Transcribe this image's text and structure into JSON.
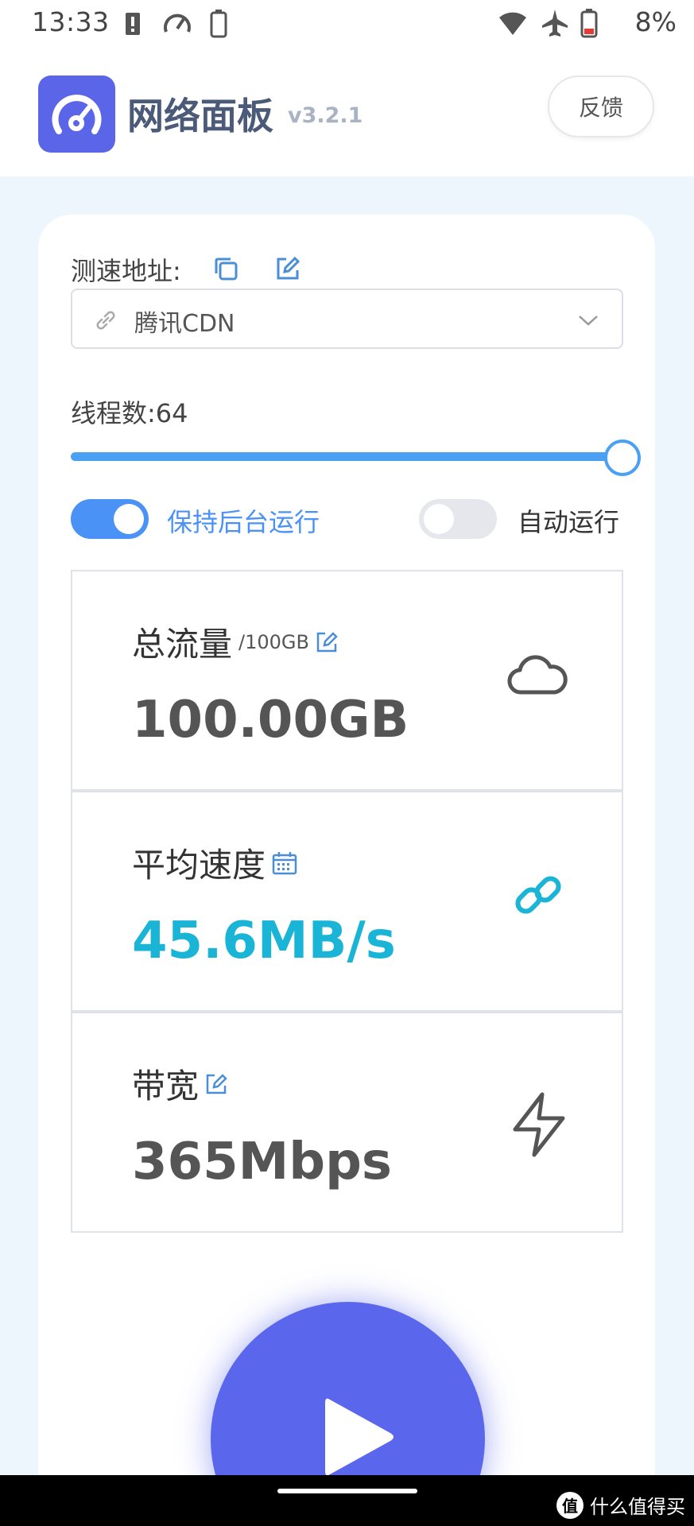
{
  "status_bar": {
    "time": "13:33",
    "battery": "8%"
  },
  "header": {
    "title": "网络面板",
    "version": "v3.2.1",
    "feedback_label": "反馈"
  },
  "url_section": {
    "label": "测速地址:",
    "selected_value": "腾讯CDN"
  },
  "threads": {
    "label": "线程数:64",
    "value": 64,
    "slider_fraction": 1.0
  },
  "toggles": {
    "background_run": {
      "label": "保持后台运行",
      "on": true
    },
    "auto_run": {
      "label": "自动运行",
      "on": false
    }
  },
  "stats": {
    "total": {
      "title": "总流量",
      "sub": "/100GB",
      "value": "100.00GB",
      "icon": "cloud-icon"
    },
    "speed": {
      "title": "平均速度",
      "value": "45.6MB/s",
      "icon": "link-chain-icon"
    },
    "bandwidth": {
      "title": "带宽",
      "value": "365Mbps",
      "icon": "lightning-icon"
    }
  },
  "colors": {
    "accent": "#4a92f5",
    "speed": "#1ab4d6",
    "button": "#5a66ec",
    "logo": "#5b65e8"
  },
  "watermark": {
    "text": "什么值得买",
    "logo_char": "值"
  }
}
